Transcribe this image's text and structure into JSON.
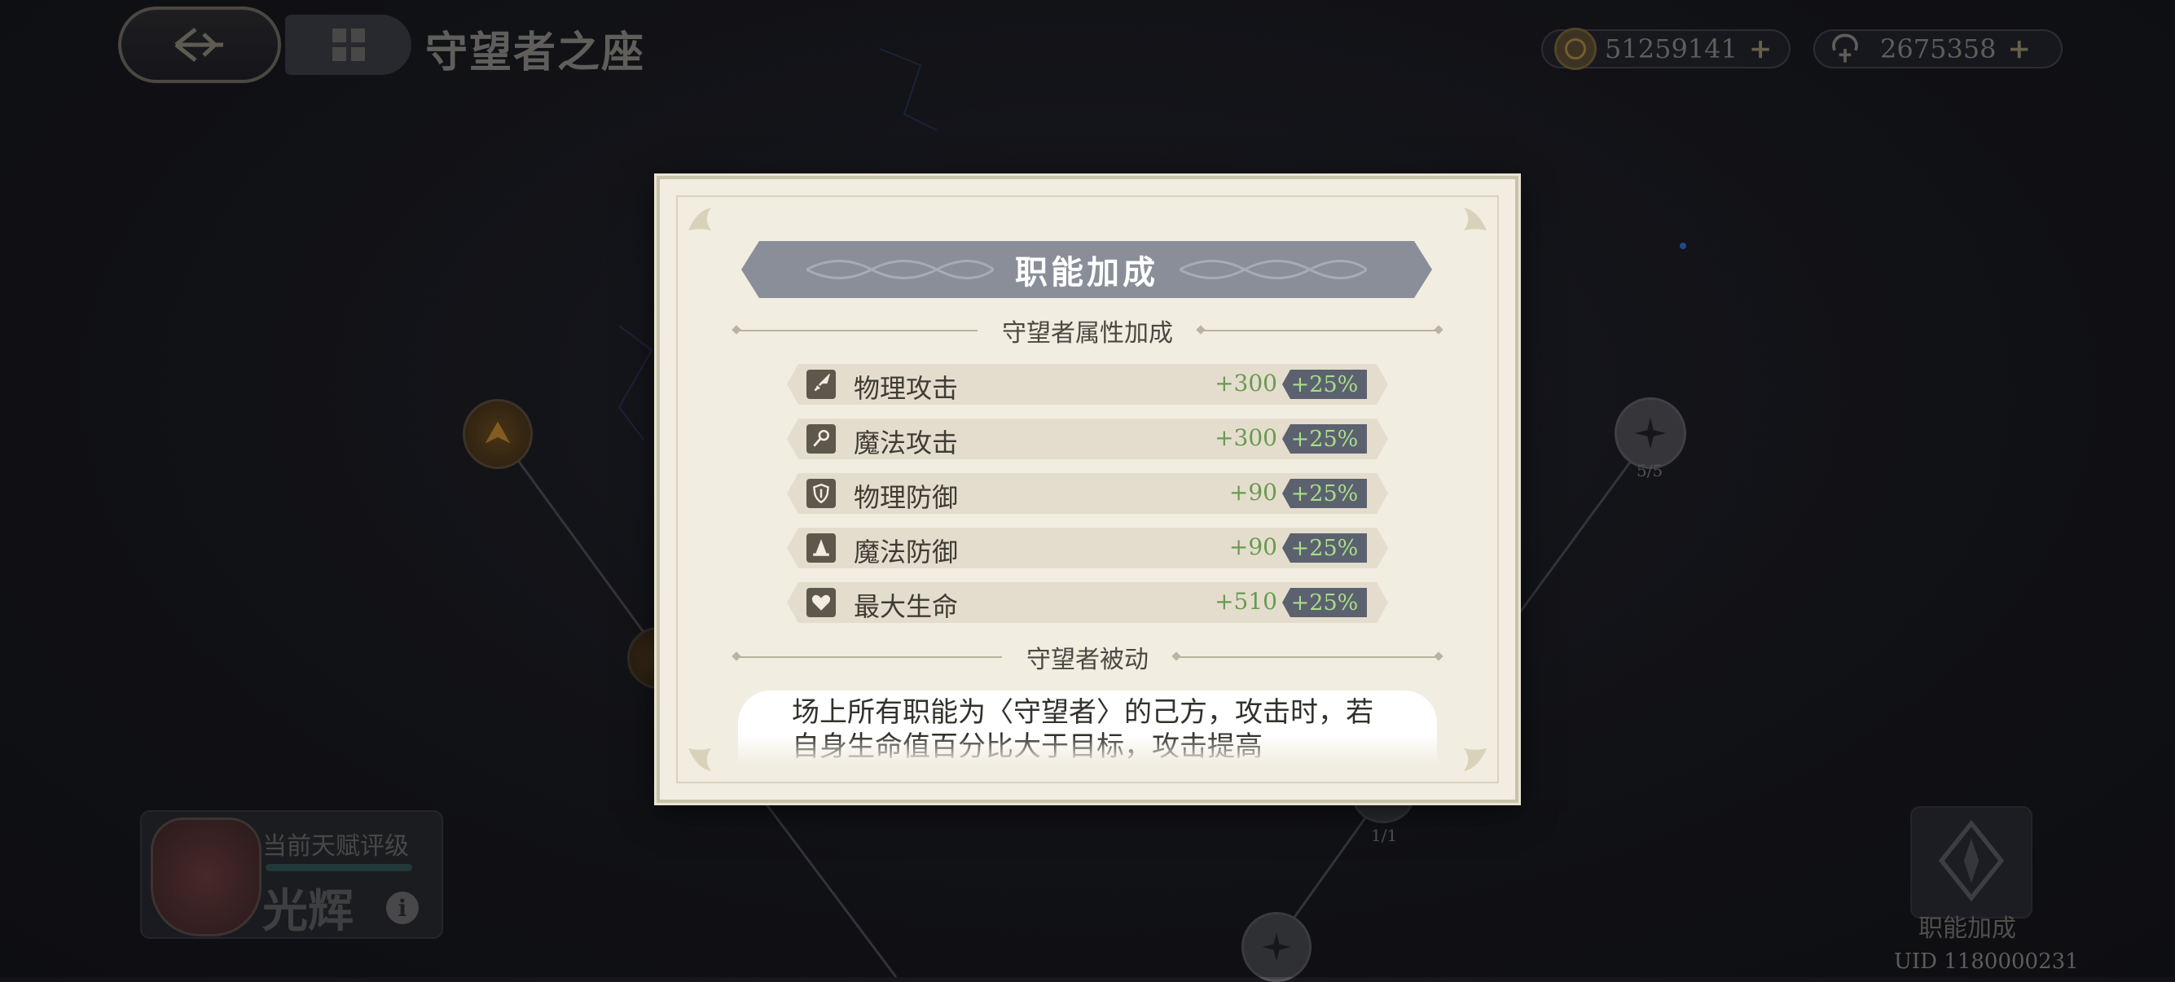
{
  "header": {
    "title": "守望者之座",
    "currencies": [
      {
        "icon": "coin-icon",
        "value": "51259141"
      },
      {
        "icon": "star-dust-icon",
        "value": "2675358"
      }
    ]
  },
  "tree": {
    "nodes": [
      {
        "label": ""
      },
      {
        "label": "5/5"
      },
      {
        "label": "1/1"
      },
      {
        "label": ""
      }
    ]
  },
  "rank": {
    "label": "当前天赋评级",
    "name": "光辉",
    "info": "i"
  },
  "bonus_button": {
    "label": "职能加成"
  },
  "uid": "UID 1180000231",
  "modal": {
    "title": "职能加成",
    "attr_section": "守望者属性加成",
    "stats": [
      {
        "icon": "sword-icon",
        "name": "物理攻击",
        "value": "+300",
        "pct": "+25%"
      },
      {
        "icon": "staff-icon",
        "name": "魔法攻击",
        "value": "+300",
        "pct": "+25%"
      },
      {
        "icon": "shield-icon",
        "name": "物理防御",
        "value": "+90",
        "pct": "+25%"
      },
      {
        "icon": "wizard-hat-icon",
        "name": "魔法防御",
        "value": "+90",
        "pct": "+25%"
      },
      {
        "icon": "heart-icon",
        "name": "最大生命",
        "value": "+510",
        "pct": "+25%"
      }
    ],
    "passive_section": "守望者被动",
    "passive_text": "场上所有职能为〈守望者〉的己方，攻击时，若自身生命值百分比大于目标，攻击提高"
  },
  "colors": {
    "accent_green": "#a8de86",
    "value_green": "#6a9a52",
    "banner": "#8a8e98",
    "modal_bg": "#f1ede0"
  }
}
